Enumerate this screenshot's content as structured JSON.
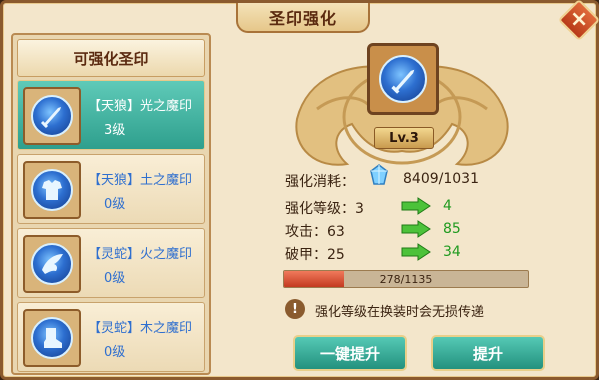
{
  "window": {
    "title": "圣印强化"
  },
  "left": {
    "header": "可强化圣印",
    "items": [
      {
        "name": "【天狼】光之魔印",
        "level": "3级",
        "icon": "sword-seal-icon"
      },
      {
        "name": "【天狼】土之魔印",
        "level": "0级",
        "icon": "armor-seal-icon"
      },
      {
        "name": "【灵蛇】火之魔印",
        "level": "0级",
        "icon": "wing-seal-icon"
      },
      {
        "name": "【灵蛇】木之魔印",
        "level": "0级",
        "icon": "boots-seal-icon"
      }
    ]
  },
  "detail": {
    "level_label": "Lv.3",
    "cost_label": "强化消耗：",
    "cost_value": "8409/1031",
    "enhance_level_label": "强化等级：3",
    "enhance_level_next": "4",
    "attack_label": "攻击：63",
    "attack_next": "85",
    "armor_pen_label": "破甲：25",
    "armor_pen_next": "34",
    "progress_text": "278/1135",
    "progress_fraction": 0.245,
    "notice": "强化等级在换装时会无损传递"
  },
  "buttons": {
    "one_click": "一键提升",
    "upgrade": "提升"
  },
  "colors": {
    "accent_teal": "#2e9f8d",
    "stat_green": "#1f9a1f",
    "progress_red": "#c33a20"
  }
}
